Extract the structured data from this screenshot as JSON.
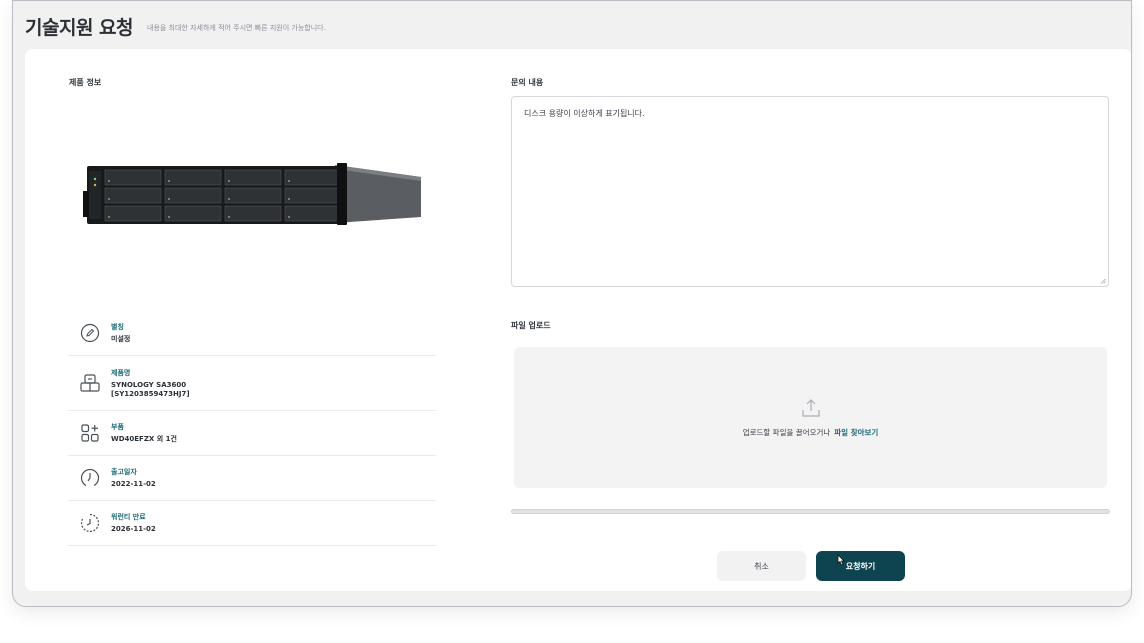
{
  "header": {
    "title": "기술지원 요청",
    "subtitle": "내용을 최대한 자세하게 적어 주시면 빠른 지원이 가능합니다."
  },
  "product_section": {
    "label": "제품 정보",
    "items": [
      {
        "icon": "pencil-circle-icon",
        "label": "별칭",
        "value": "미설정"
      },
      {
        "icon": "server-icon",
        "label": "제품명",
        "value": "SYNOLOGY SA3600",
        "value2": "[SY1203859473HJ7]"
      },
      {
        "icon": "components-icon",
        "label": "부품",
        "value": "WD40EFZX 외 1건"
      },
      {
        "icon": "clock-icon",
        "label": "출고일자",
        "value": "2022-11-02"
      },
      {
        "icon": "timer-icon",
        "label": "워런티 만료",
        "value": "2026-11-02"
      }
    ]
  },
  "inquiry": {
    "label": "문의 내용",
    "value": "디스크 용량이 이상하게 표기됩니다."
  },
  "upload": {
    "label": "파일 업로드",
    "drop_text": "업로드할 파일을 끌어오거나",
    "browse_text": "파일 찾아보기",
    "progress": 0
  },
  "actions": {
    "cancel": "취소",
    "submit": "요청하기"
  },
  "colors": {
    "accent": "#1b6b77",
    "primary_button": "#0e4450",
    "background": "#f1f1f2"
  }
}
